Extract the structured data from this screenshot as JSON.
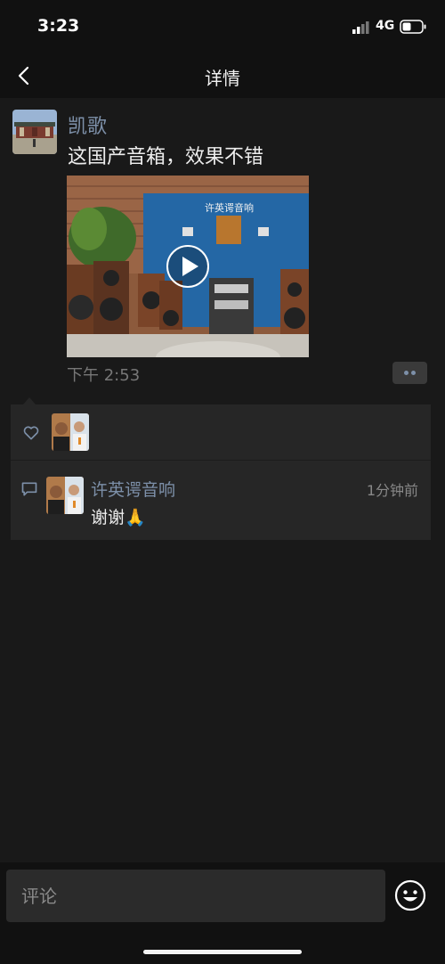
{
  "status_bar": {
    "time": "3:23",
    "network": "4G"
  },
  "nav": {
    "title": "详情"
  },
  "post": {
    "author": "凯歌",
    "text": "这国产音箱，效果不错",
    "video_sign_text": "许英谔音响",
    "time": "下午 2:53"
  },
  "likes": {
    "count": 1
  },
  "comments": [
    {
      "author": "许英谔音响",
      "time": "1分钟前",
      "text": "谢谢🙏"
    }
  ],
  "input": {
    "placeholder": "评论"
  },
  "colors": {
    "accent": "#7d90a9",
    "background": "#191919",
    "panel": "#262626"
  }
}
